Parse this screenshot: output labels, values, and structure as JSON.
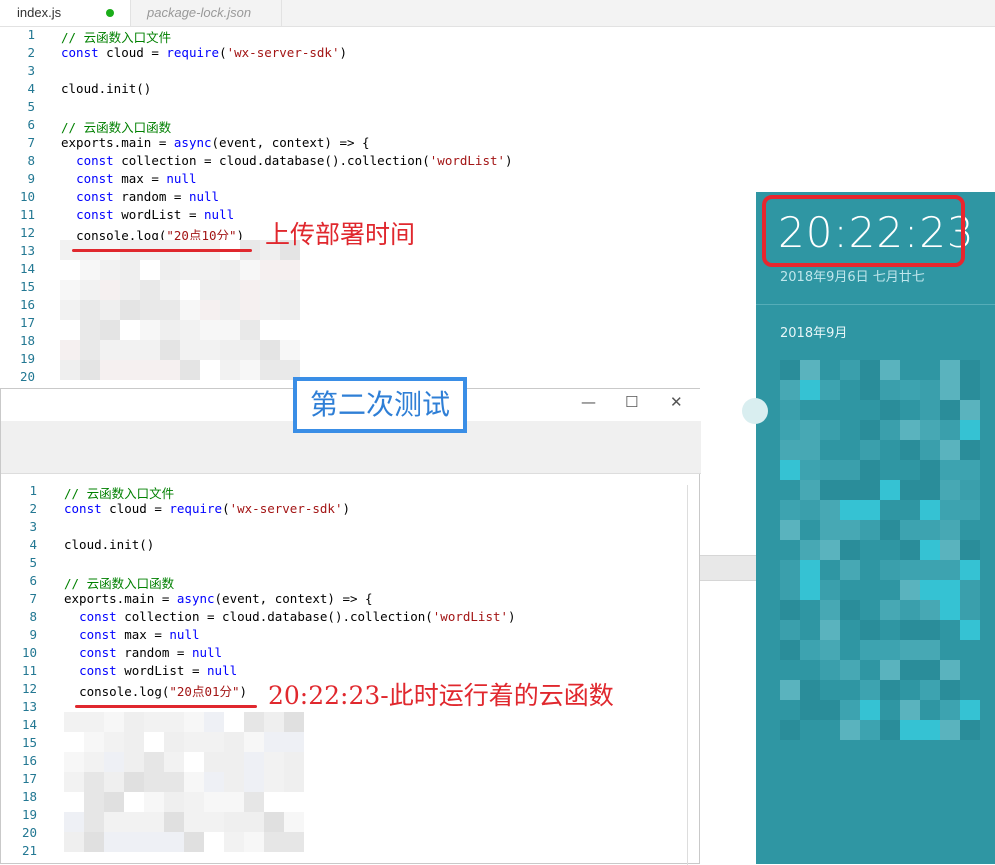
{
  "tabs": [
    {
      "label": "index.js",
      "modified": true
    },
    {
      "label": "package-lock.json",
      "modified": false
    }
  ],
  "top_editor": {
    "line_numbers": [
      "1",
      "2",
      "3",
      "4",
      "5",
      "6",
      "7",
      "8",
      "9",
      "10",
      "11",
      "12",
      "13",
      "14",
      "15",
      "16",
      "17",
      "18",
      "19",
      "20"
    ],
    "lines": [
      {
        "c": "// 云函数入口文件"
      },
      {
        "k1": "const",
        "t1": " cloud = ",
        "k2": "require",
        "t2": "(",
        "s": "'wx-server-sdk'",
        "t3": ")"
      },
      {},
      {
        "t1": "cloud.init()"
      },
      {},
      {
        "c": "// 云函数入口函数"
      },
      {
        "t1": "exports.main = ",
        "k2": "async",
        "t2": "(event, context) => {"
      },
      {
        "ind": "  ",
        "k1": "const",
        "t1": " collection = cloud.database().collection(",
        "s": "'wordList'",
        "t3": ")"
      },
      {
        "ind": "  ",
        "k1": "const",
        "t1": " max = ",
        "k2": "null"
      },
      {
        "ind": "  ",
        "k1": "const",
        "t1": " random = ",
        "k2": "null"
      },
      {
        "ind": "  ",
        "k1": "const",
        "t1": " wordList = ",
        "k2": "null"
      },
      {
        "ind": "  ",
        "t1": "console.log(",
        "s": "\"20点10分\"",
        "t3": ")"
      }
    ],
    "annotation": "上传部署时间"
  },
  "badge_label": "第二次测试",
  "window_controls": {
    "minimize": "—",
    "maximize": "☐",
    "close": "✕"
  },
  "bottom_editor": {
    "line_numbers": [
      "1",
      "2",
      "3",
      "4",
      "5",
      "6",
      "7",
      "8",
      "9",
      "10",
      "11",
      "12",
      "13",
      "14",
      "15",
      "16",
      "17",
      "18",
      "19",
      "20",
      "21"
    ],
    "lines": [
      {
        "c": "// 云函数入口文件"
      },
      {
        "k1": "const",
        "t1": " cloud = ",
        "k2": "require",
        "t2": "(",
        "s": "'wx-server-sdk'",
        "t3": ")"
      },
      {},
      {
        "t1": "cloud.init()"
      },
      {},
      {
        "c": "// 云函数入口函数"
      },
      {
        "t1": "exports.main = ",
        "k2": "async",
        "t2": "(event, context) => {"
      },
      {
        "ind": "  ",
        "k1": "const",
        "t1": " collection = cloud.database().collection(",
        "s": "'wordList'",
        "t3": ")"
      },
      {
        "ind": "  ",
        "k1": "const",
        "t1": " max = ",
        "k2": "null"
      },
      {
        "ind": "  ",
        "k1": "const",
        "t1": " random = ",
        "k2": "null"
      },
      {
        "ind": "  ",
        "k1": "const",
        "t1": " wordList = ",
        "k2": "null"
      },
      {
        "ind": "  ",
        "t1": "console.log(",
        "s": "\"20点01分\"",
        "t3": ")"
      }
    ],
    "annotation": "20:22:23-此时运行着的云函数"
  },
  "clock_panel": {
    "time": "20:22:23",
    "date": "2018年9月6日 七月廿七",
    "month": "2018年9月",
    "colors": {
      "panel": "#2f96a3",
      "highlight_box": "#e8262e"
    }
  },
  "colors": {
    "annotation": "#e0282e",
    "badge": "#2f7fd6",
    "line_number": "#237893",
    "comment": "#008000",
    "keyword": "#0000ff",
    "string": "#a31515"
  }
}
